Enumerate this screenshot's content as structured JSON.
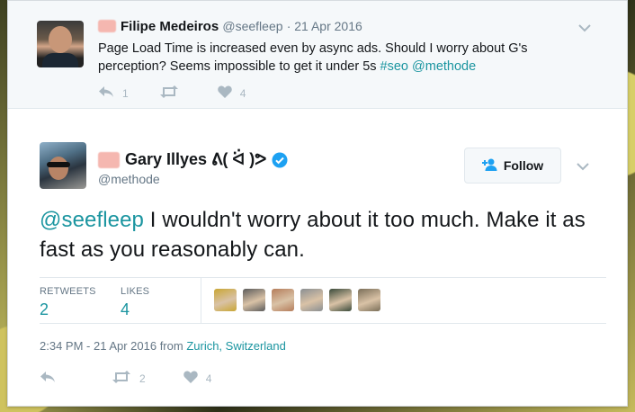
{
  "parent_tweet": {
    "name": "Filipe Medeiros",
    "handle": "@seefleep",
    "date": "· 21 Apr 2016",
    "text_plain": "Page Load Time is increased even by async ads. Should I worry about G's perception? Seems impossible to get it under 5s ",
    "hashtag": "#seo",
    "mention": "@methode",
    "reply_count": "1",
    "retweet_count": "",
    "like_count": "4"
  },
  "main_tweet": {
    "name": "Gary Illyes ᕕ( ᐛ )ᕗ",
    "handle": "@methode",
    "follow_label": "Follow",
    "mention": "@seefleep",
    "text_plain": " I wouldn't worry about it too much. Make it as fast as you reasonably can.",
    "retweets_label": "RETWEETS",
    "retweets_value": "2",
    "likes_label": "LIKES",
    "likes_value": "4",
    "time_prefix": "2:34 PM - 21 Apr 2016 from ",
    "location": "Zurich, Switzerland",
    "action_retweet_count": "2",
    "action_like_count": "4"
  },
  "liker_colors": [
    "#c9a634",
    "#5b5b5b",
    "#b57d5b",
    "#8a8f92",
    "#3a4a3a",
    "#7a6e58"
  ],
  "colors": {
    "link": "#1b95a0",
    "muted": "#657786",
    "icon": "#aab8c2",
    "verified": "#1da1f2"
  }
}
